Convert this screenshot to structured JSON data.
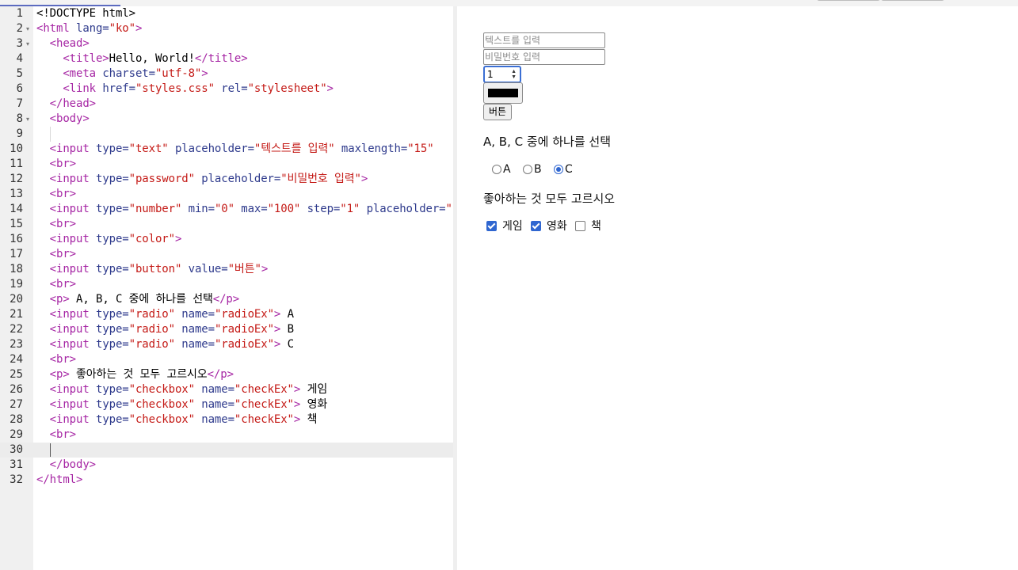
{
  "editor": {
    "lines": [
      {
        "n": "1",
        "fold": "",
        "parts": [
          [
            "txt",
            "<!DOCTYPE html>"
          ]
        ]
      },
      {
        "n": "2",
        "fold": "▾",
        "parts": [
          [
            "tag",
            "<html "
          ],
          [
            "attr",
            "lang="
          ],
          [
            "str",
            "\"ko\""
          ],
          [
            "tag",
            ">"
          ]
        ]
      },
      {
        "n": "3",
        "fold": "▾",
        "parts": [
          [
            "txt",
            "  "
          ],
          [
            "tag",
            "<head>"
          ]
        ]
      },
      {
        "n": "4",
        "fold": "",
        "parts": [
          [
            "txt",
            "    "
          ],
          [
            "tag",
            "<title>"
          ],
          [
            "txt",
            "Hello, World!"
          ],
          [
            "tag",
            "</title>"
          ]
        ]
      },
      {
        "n": "5",
        "fold": "",
        "parts": [
          [
            "txt",
            "    "
          ],
          [
            "tag",
            "<meta "
          ],
          [
            "attr",
            "charset="
          ],
          [
            "str",
            "\"utf-8\""
          ],
          [
            "tag",
            ">"
          ]
        ]
      },
      {
        "n": "6",
        "fold": "",
        "parts": [
          [
            "txt",
            "    "
          ],
          [
            "tag",
            "<link "
          ],
          [
            "attr",
            "href="
          ],
          [
            "str",
            "\"styles.css\""
          ],
          [
            "attr",
            " rel="
          ],
          [
            "str",
            "\"stylesheet\""
          ],
          [
            "tag",
            ">"
          ]
        ]
      },
      {
        "n": "7",
        "fold": "",
        "parts": [
          [
            "txt",
            "  "
          ],
          [
            "tag",
            "</head>"
          ]
        ]
      },
      {
        "n": "8",
        "fold": "▾",
        "parts": [
          [
            "txt",
            "  "
          ],
          [
            "tag",
            "<body>"
          ]
        ]
      },
      {
        "n": "9",
        "fold": "",
        "parts": [
          [
            "txt",
            "  "
          ]
        ]
      },
      {
        "n": "10",
        "fold": "",
        "parts": [
          [
            "txt",
            "  "
          ],
          [
            "tag",
            "<input "
          ],
          [
            "attr",
            "type="
          ],
          [
            "str",
            "\"text\""
          ],
          [
            "attr",
            " placeholder="
          ],
          [
            "str",
            "\"텍스트를 입력\""
          ],
          [
            "attr",
            " maxlength="
          ],
          [
            "str",
            "\"15\""
          ]
        ]
      },
      {
        "n": "11",
        "fold": "",
        "parts": [
          [
            "txt",
            "  "
          ],
          [
            "tag",
            "<br>"
          ]
        ]
      },
      {
        "n": "12",
        "fold": "",
        "parts": [
          [
            "txt",
            "  "
          ],
          [
            "tag",
            "<input "
          ],
          [
            "attr",
            "type="
          ],
          [
            "str",
            "\"password\""
          ],
          [
            "attr",
            " placeholder="
          ],
          [
            "str",
            "\"비밀번호 입력\""
          ],
          [
            "tag",
            ">"
          ]
        ]
      },
      {
        "n": "13",
        "fold": "",
        "parts": [
          [
            "txt",
            "  "
          ],
          [
            "tag",
            "<br>"
          ]
        ]
      },
      {
        "n": "14",
        "fold": "",
        "parts": [
          [
            "txt",
            "  "
          ],
          [
            "tag",
            "<input "
          ],
          [
            "attr",
            "type="
          ],
          [
            "str",
            "\"number\""
          ],
          [
            "attr",
            " min="
          ],
          [
            "str",
            "\"0\""
          ],
          [
            "attr",
            " max="
          ],
          [
            "str",
            "\"100\""
          ],
          [
            "attr",
            " step="
          ],
          [
            "str",
            "\"1\""
          ],
          [
            "attr",
            " placeholder="
          ],
          [
            "str",
            "\""
          ]
        ]
      },
      {
        "n": "15",
        "fold": "",
        "parts": [
          [
            "txt",
            "  "
          ],
          [
            "tag",
            "<br>"
          ]
        ]
      },
      {
        "n": "16",
        "fold": "",
        "parts": [
          [
            "txt",
            "  "
          ],
          [
            "tag",
            "<input "
          ],
          [
            "attr",
            "type="
          ],
          [
            "str",
            "\"color\""
          ],
          [
            "tag",
            ">"
          ]
        ]
      },
      {
        "n": "17",
        "fold": "",
        "parts": [
          [
            "txt",
            "  "
          ],
          [
            "tag",
            "<br>"
          ]
        ]
      },
      {
        "n": "18",
        "fold": "",
        "parts": [
          [
            "txt",
            "  "
          ],
          [
            "tag",
            "<input "
          ],
          [
            "attr",
            "type="
          ],
          [
            "str",
            "\"button\""
          ],
          [
            "attr",
            " value="
          ],
          [
            "str",
            "\"버튼\""
          ],
          [
            "tag",
            ">"
          ]
        ]
      },
      {
        "n": "19",
        "fold": "",
        "parts": [
          [
            "txt",
            "  "
          ],
          [
            "tag",
            "<br>"
          ]
        ]
      },
      {
        "n": "20",
        "fold": "",
        "parts": [
          [
            "txt",
            "  "
          ],
          [
            "tag",
            "<p>"
          ],
          [
            "txt",
            " A, B, C 중에 하나를 선택"
          ],
          [
            "tag",
            "</p>"
          ]
        ]
      },
      {
        "n": "21",
        "fold": "",
        "parts": [
          [
            "txt",
            "  "
          ],
          [
            "tag",
            "<input "
          ],
          [
            "attr",
            "type="
          ],
          [
            "str",
            "\"radio\""
          ],
          [
            "attr",
            " name="
          ],
          [
            "str",
            "\"radioEx\""
          ],
          [
            "tag",
            ">"
          ],
          [
            "txt",
            " A"
          ]
        ]
      },
      {
        "n": "22",
        "fold": "",
        "parts": [
          [
            "txt",
            "  "
          ],
          [
            "tag",
            "<input "
          ],
          [
            "attr",
            "type="
          ],
          [
            "str",
            "\"radio\""
          ],
          [
            "attr",
            " name="
          ],
          [
            "str",
            "\"radioEx\""
          ],
          [
            "tag",
            ">"
          ],
          [
            "txt",
            " B"
          ]
        ]
      },
      {
        "n": "23",
        "fold": "",
        "parts": [
          [
            "txt",
            "  "
          ],
          [
            "tag",
            "<input "
          ],
          [
            "attr",
            "type="
          ],
          [
            "str",
            "\"radio\""
          ],
          [
            "attr",
            " name="
          ],
          [
            "str",
            "\"radioEx\""
          ],
          [
            "tag",
            ">"
          ],
          [
            "txt",
            " C"
          ]
        ]
      },
      {
        "n": "24",
        "fold": "",
        "parts": [
          [
            "txt",
            "  "
          ],
          [
            "tag",
            "<br>"
          ]
        ]
      },
      {
        "n": "25",
        "fold": "",
        "parts": [
          [
            "txt",
            "  "
          ],
          [
            "tag",
            "<p>"
          ],
          [
            "txt",
            " 좋아하는 것 모두 고르시오"
          ],
          [
            "tag",
            "</p>"
          ]
        ]
      },
      {
        "n": "26",
        "fold": "",
        "parts": [
          [
            "txt",
            "  "
          ],
          [
            "tag",
            "<input "
          ],
          [
            "attr",
            "type="
          ],
          [
            "str",
            "\"checkbox\""
          ],
          [
            "attr",
            " name="
          ],
          [
            "str",
            "\"checkEx\""
          ],
          [
            "tag",
            ">"
          ],
          [
            "txt",
            " 게임"
          ]
        ]
      },
      {
        "n": "27",
        "fold": "",
        "parts": [
          [
            "txt",
            "  "
          ],
          [
            "tag",
            "<input "
          ],
          [
            "attr",
            "type="
          ],
          [
            "str",
            "\"checkbox\""
          ],
          [
            "attr",
            " name="
          ],
          [
            "str",
            "\"checkEx\""
          ],
          [
            "tag",
            ">"
          ],
          [
            "txt",
            " 영화"
          ]
        ]
      },
      {
        "n": "28",
        "fold": "",
        "parts": [
          [
            "txt",
            "  "
          ],
          [
            "tag",
            "<input "
          ],
          [
            "attr",
            "type="
          ],
          [
            "str",
            "\"checkbox\""
          ],
          [
            "attr",
            " name="
          ],
          [
            "str",
            "\"checkEx\""
          ],
          [
            "tag",
            ">"
          ],
          [
            "txt",
            " 책"
          ]
        ]
      },
      {
        "n": "29",
        "fold": "",
        "parts": [
          [
            "txt",
            "  "
          ],
          [
            "tag",
            "<br>"
          ]
        ]
      },
      {
        "n": "30",
        "fold": "",
        "parts": [
          [
            "txt",
            "  "
          ]
        ],
        "active": true,
        "cursor": true
      },
      {
        "n": "31",
        "fold": "",
        "parts": [
          [
            "txt",
            "  "
          ],
          [
            "tag",
            "</body>"
          ]
        ]
      },
      {
        "n": "32",
        "fold": "",
        "parts": [
          [
            "tag",
            "</html>"
          ]
        ]
      }
    ]
  },
  "preview": {
    "text_placeholder": "텍스트를 입력",
    "password_placeholder": "비밀번호 입력",
    "number_value": "1",
    "color_value": "#000000",
    "button_label": "버튼",
    "radio_question": "A, B, C 중에 하나를 선택",
    "radio_options": [
      {
        "label": "A",
        "checked": false
      },
      {
        "label": "B",
        "checked": false
      },
      {
        "label": "C",
        "checked": true
      }
    ],
    "checkbox_question": "좋아하는 것 모두 고르시오",
    "checkbox_options": [
      {
        "label": "게임",
        "checked": true
      },
      {
        "label": "영화",
        "checked": true
      },
      {
        "label": "책",
        "checked": false
      }
    ]
  }
}
